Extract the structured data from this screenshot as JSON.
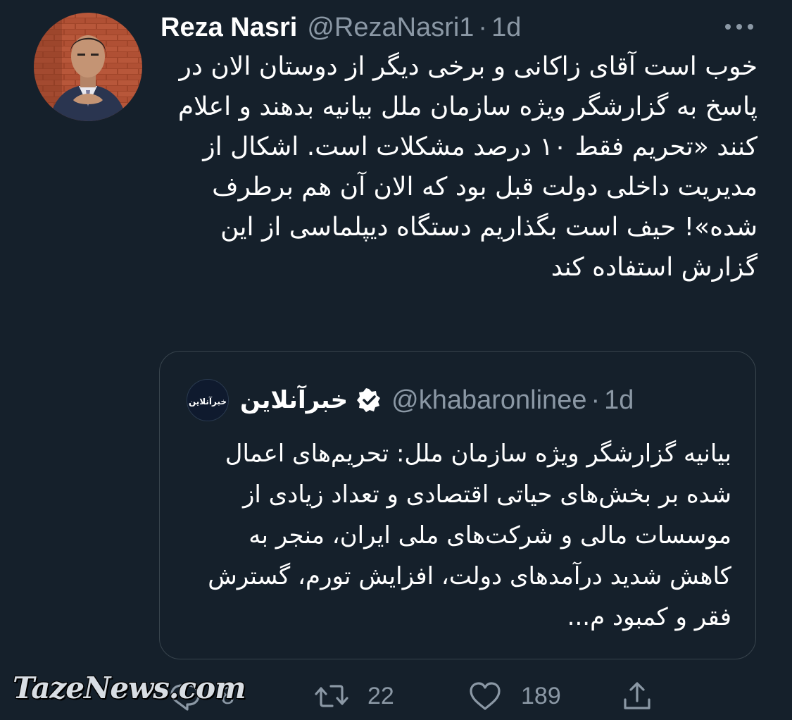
{
  "tweet": {
    "author_name": "Reza Nasri",
    "handle": "@RezaNasri1",
    "separator": "·",
    "time": "1d",
    "more_icon": "more-horizontal-icon",
    "text": "خوب است آقای زاکانی و برخی دیگر از دوستان الان در پاسخ به گزارشگر ویژه سازمان ملل بیانیه بدهند و اعلام کنند «تحریم فقط ۱۰ درصد مشکلات است. اشکال از مدیریت داخلی دولت قبل بود که الان آن هم برطرف شده»! حیف است بگذاریم دستگاه دیپلماسی از این گزارش استفاده کند"
  },
  "quote": {
    "author_name": "خبرآنلاین",
    "logo_text": "خبرآنلاین",
    "verified_icon": "verified-badge-icon",
    "handle": "@khabaronlinee",
    "separator": "·",
    "time": "1d",
    "text": "بیانیه گزارشگر ویژه سازمان ملل: تحریم‌های اعمال شده بر بخش‌های حیاتی اقتصادی و تعداد زیادی از موسسات مالی و شرکت‌های ملی ایران، منجر به کاهش شدید درآمدهای دولت، افزایش تورم، گسترش فقر و کمبود م..."
  },
  "actions": {
    "reply": {
      "icon": "reply-icon",
      "count": "8"
    },
    "retweet": {
      "icon": "retweet-icon",
      "count": "22"
    },
    "like": {
      "icon": "heart-icon",
      "count": "189"
    },
    "share": {
      "icon": "share-icon"
    }
  },
  "watermark": "TazeNews.com",
  "colors": {
    "background": "#15202b",
    "text": "#ffffff",
    "secondary": "#8b98a5",
    "border": "#38444d"
  }
}
